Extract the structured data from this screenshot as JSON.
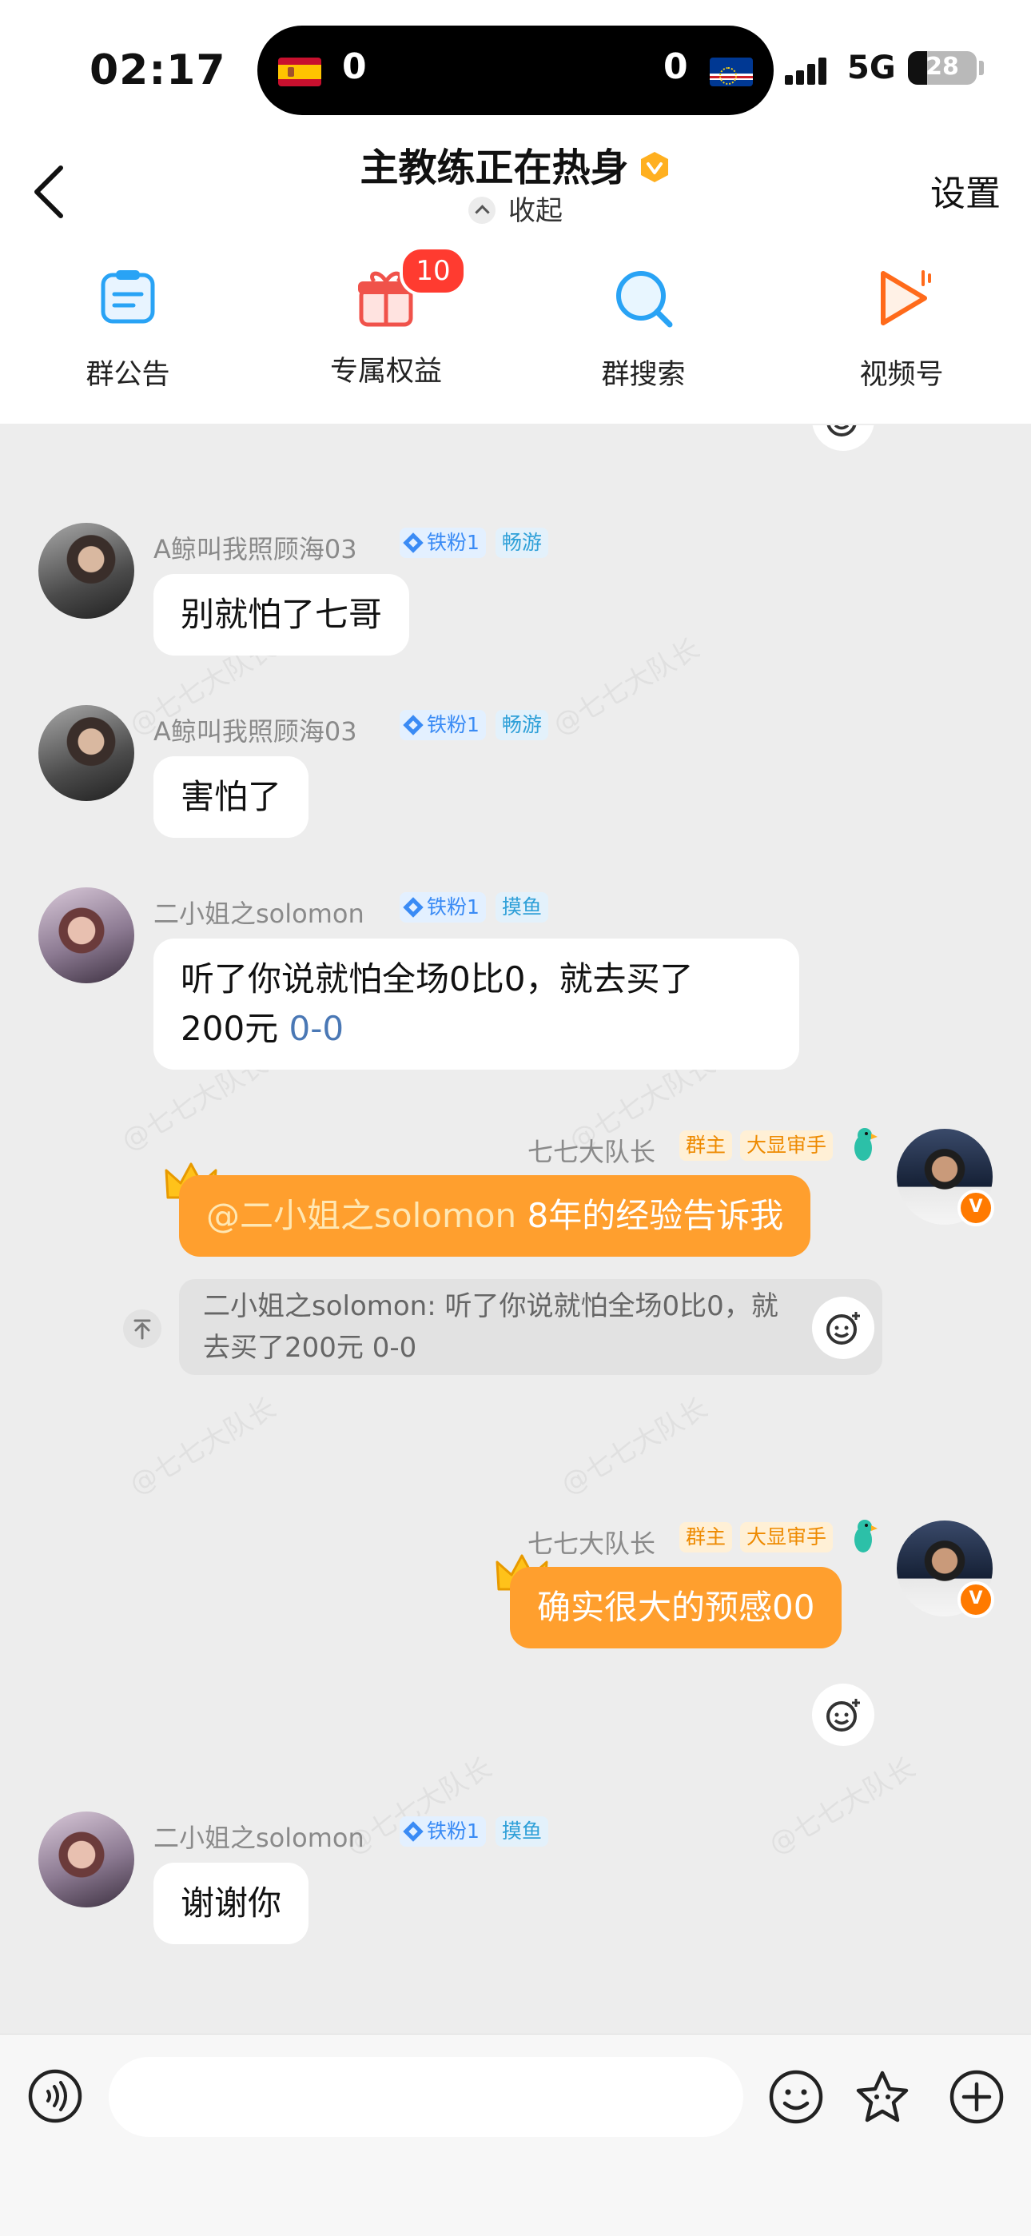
{
  "status_bar": {
    "time": "02:17",
    "score_left": "0",
    "score_right": "0",
    "network": "5G",
    "battery": "28"
  },
  "header": {
    "title": "主教练正在热身",
    "collapse_label": "收起",
    "settings_label": "设置"
  },
  "quick_actions": [
    {
      "label": "群公告",
      "icon": "announcement-icon"
    },
    {
      "label": "专属权益",
      "icon": "gift-icon",
      "badge": "10"
    },
    {
      "label": "群搜索",
      "icon": "search-icon"
    },
    {
      "label": "视频号",
      "icon": "video-play-icon"
    }
  ],
  "watermark": "@七七大队长",
  "messages": [
    {
      "sender": "A鲸叫我照顾海03",
      "tags": [
        "铁粉1",
        "畅游"
      ],
      "text": "别就怕了七哥"
    },
    {
      "sender": "A鲸叫我照顾海03",
      "tags": [
        "铁粉1",
        "畅游"
      ],
      "text": "害怕了"
    },
    {
      "sender": "二小姐之solomon",
      "tags": [
        "铁粉1",
        "摸鱼"
      ],
      "text_line1": "听了你说就怕全场0比0，就去买了",
      "text_line2_prefix": "200元 ",
      "text_line2_link": "0-0"
    },
    {
      "sender": "七七大队长",
      "tags": [
        "群主",
        "大显审手"
      ],
      "mention": "@二小姐之solomon",
      "text": " 8年的经验告诉我",
      "quote_line1": "二小姐之solomon: 听了你说就怕全场0比0，就",
      "quote_line2": "去买了200元 0-0"
    },
    {
      "sender": "七七大队长",
      "tags": [
        "群主",
        "大显审手"
      ],
      "text": "确实很大的预感00"
    },
    {
      "sender": "二小姐之solomon",
      "tags": [
        "铁粉1",
        "摸鱼"
      ],
      "text": "谢谢你"
    }
  ]
}
